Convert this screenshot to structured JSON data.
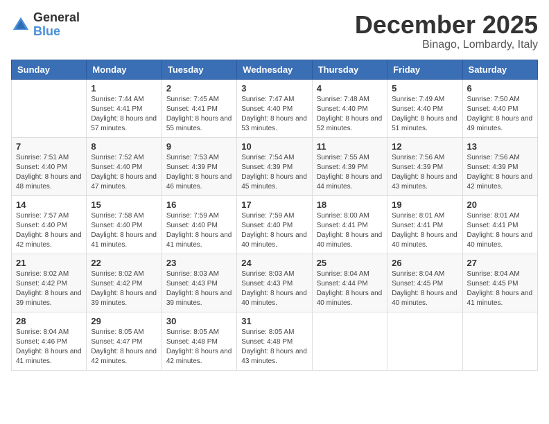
{
  "logo": {
    "general": "General",
    "blue": "Blue"
  },
  "header": {
    "month": "December 2025",
    "location": "Binago, Lombardy, Italy"
  },
  "days": [
    "Sunday",
    "Monday",
    "Tuesday",
    "Wednesday",
    "Thursday",
    "Friday",
    "Saturday"
  ],
  "weeks": [
    [
      {
        "day": "",
        "sunrise": "",
        "sunset": "",
        "daylight": ""
      },
      {
        "day": "1",
        "sunrise": "Sunrise: 7:44 AM",
        "sunset": "Sunset: 4:41 PM",
        "daylight": "Daylight: 8 hours and 57 minutes."
      },
      {
        "day": "2",
        "sunrise": "Sunrise: 7:45 AM",
        "sunset": "Sunset: 4:41 PM",
        "daylight": "Daylight: 8 hours and 55 minutes."
      },
      {
        "day": "3",
        "sunrise": "Sunrise: 7:47 AM",
        "sunset": "Sunset: 4:40 PM",
        "daylight": "Daylight: 8 hours and 53 minutes."
      },
      {
        "day": "4",
        "sunrise": "Sunrise: 7:48 AM",
        "sunset": "Sunset: 4:40 PM",
        "daylight": "Daylight: 8 hours and 52 minutes."
      },
      {
        "day": "5",
        "sunrise": "Sunrise: 7:49 AM",
        "sunset": "Sunset: 4:40 PM",
        "daylight": "Daylight: 8 hours and 51 minutes."
      },
      {
        "day": "6",
        "sunrise": "Sunrise: 7:50 AM",
        "sunset": "Sunset: 4:40 PM",
        "daylight": "Daylight: 8 hours and 49 minutes."
      }
    ],
    [
      {
        "day": "7",
        "sunrise": "Sunrise: 7:51 AM",
        "sunset": "Sunset: 4:40 PM",
        "daylight": "Daylight: 8 hours and 48 minutes."
      },
      {
        "day": "8",
        "sunrise": "Sunrise: 7:52 AM",
        "sunset": "Sunset: 4:40 PM",
        "daylight": "Daylight: 8 hours and 47 minutes."
      },
      {
        "day": "9",
        "sunrise": "Sunrise: 7:53 AM",
        "sunset": "Sunset: 4:39 PM",
        "daylight": "Daylight: 8 hours and 46 minutes."
      },
      {
        "day": "10",
        "sunrise": "Sunrise: 7:54 AM",
        "sunset": "Sunset: 4:39 PM",
        "daylight": "Daylight: 8 hours and 45 minutes."
      },
      {
        "day": "11",
        "sunrise": "Sunrise: 7:55 AM",
        "sunset": "Sunset: 4:39 PM",
        "daylight": "Daylight: 8 hours and 44 minutes."
      },
      {
        "day": "12",
        "sunrise": "Sunrise: 7:56 AM",
        "sunset": "Sunset: 4:39 PM",
        "daylight": "Daylight: 8 hours and 43 minutes."
      },
      {
        "day": "13",
        "sunrise": "Sunrise: 7:56 AM",
        "sunset": "Sunset: 4:39 PM",
        "daylight": "Daylight: 8 hours and 42 minutes."
      }
    ],
    [
      {
        "day": "14",
        "sunrise": "Sunrise: 7:57 AM",
        "sunset": "Sunset: 4:40 PM",
        "daylight": "Daylight: 8 hours and 42 minutes."
      },
      {
        "day": "15",
        "sunrise": "Sunrise: 7:58 AM",
        "sunset": "Sunset: 4:40 PM",
        "daylight": "Daylight: 8 hours and 41 minutes."
      },
      {
        "day": "16",
        "sunrise": "Sunrise: 7:59 AM",
        "sunset": "Sunset: 4:40 PM",
        "daylight": "Daylight: 8 hours and 41 minutes."
      },
      {
        "day": "17",
        "sunrise": "Sunrise: 7:59 AM",
        "sunset": "Sunset: 4:40 PM",
        "daylight": "Daylight: 8 hours and 40 minutes."
      },
      {
        "day": "18",
        "sunrise": "Sunrise: 8:00 AM",
        "sunset": "Sunset: 4:41 PM",
        "daylight": "Daylight: 8 hours and 40 minutes."
      },
      {
        "day": "19",
        "sunrise": "Sunrise: 8:01 AM",
        "sunset": "Sunset: 4:41 PM",
        "daylight": "Daylight: 8 hours and 40 minutes."
      },
      {
        "day": "20",
        "sunrise": "Sunrise: 8:01 AM",
        "sunset": "Sunset: 4:41 PM",
        "daylight": "Daylight: 8 hours and 40 minutes."
      }
    ],
    [
      {
        "day": "21",
        "sunrise": "Sunrise: 8:02 AM",
        "sunset": "Sunset: 4:42 PM",
        "daylight": "Daylight: 8 hours and 39 minutes."
      },
      {
        "day": "22",
        "sunrise": "Sunrise: 8:02 AM",
        "sunset": "Sunset: 4:42 PM",
        "daylight": "Daylight: 8 hours and 39 minutes."
      },
      {
        "day": "23",
        "sunrise": "Sunrise: 8:03 AM",
        "sunset": "Sunset: 4:43 PM",
        "daylight": "Daylight: 8 hours and 39 minutes."
      },
      {
        "day": "24",
        "sunrise": "Sunrise: 8:03 AM",
        "sunset": "Sunset: 4:43 PM",
        "daylight": "Daylight: 8 hours and 40 minutes."
      },
      {
        "day": "25",
        "sunrise": "Sunrise: 8:04 AM",
        "sunset": "Sunset: 4:44 PM",
        "daylight": "Daylight: 8 hours and 40 minutes."
      },
      {
        "day": "26",
        "sunrise": "Sunrise: 8:04 AM",
        "sunset": "Sunset: 4:45 PM",
        "daylight": "Daylight: 8 hours and 40 minutes."
      },
      {
        "day": "27",
        "sunrise": "Sunrise: 8:04 AM",
        "sunset": "Sunset: 4:45 PM",
        "daylight": "Daylight: 8 hours and 41 minutes."
      }
    ],
    [
      {
        "day": "28",
        "sunrise": "Sunrise: 8:04 AM",
        "sunset": "Sunset: 4:46 PM",
        "daylight": "Daylight: 8 hours and 41 minutes."
      },
      {
        "day": "29",
        "sunrise": "Sunrise: 8:05 AM",
        "sunset": "Sunset: 4:47 PM",
        "daylight": "Daylight: 8 hours and 42 minutes."
      },
      {
        "day": "30",
        "sunrise": "Sunrise: 8:05 AM",
        "sunset": "Sunset: 4:48 PM",
        "daylight": "Daylight: 8 hours and 42 minutes."
      },
      {
        "day": "31",
        "sunrise": "Sunrise: 8:05 AM",
        "sunset": "Sunset: 4:48 PM",
        "daylight": "Daylight: 8 hours and 43 minutes."
      },
      {
        "day": "",
        "sunrise": "",
        "sunset": "",
        "daylight": ""
      },
      {
        "day": "",
        "sunrise": "",
        "sunset": "",
        "daylight": ""
      },
      {
        "day": "",
        "sunrise": "",
        "sunset": "",
        "daylight": ""
      }
    ]
  ]
}
